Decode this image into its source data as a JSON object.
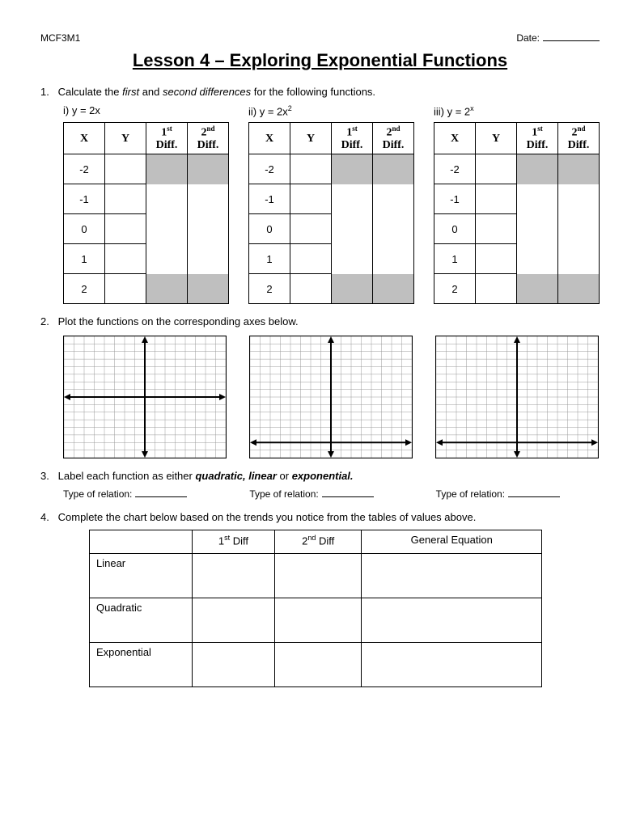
{
  "header": {
    "course": "MCF3M1",
    "date_label": "Date:"
  },
  "title": "Lesson 4 – Exploring Exponential Functions",
  "q1": {
    "num": "1.",
    "text_a": "Calculate the ",
    "text_b": "first",
    "text_c": " and ",
    "text_d": "second differences",
    "text_e": " for the following functions.",
    "funcs": [
      {
        "label": "i)   y = 2x"
      },
      {
        "label_pre": "ii)  y = 2x",
        "label_sup": "2"
      },
      {
        "label_pre": "iii)  y = 2",
        "label_sup": "x"
      }
    ],
    "table_headers": {
      "x": "X",
      "y": "Y",
      "d1a": "1",
      "d1s": "st",
      "d1b": "Diff.",
      "d2a": "2",
      "d2s": "nd",
      "d2b": "Diff."
    },
    "x_values": [
      "-2",
      "-1",
      "0",
      "1",
      "2"
    ]
  },
  "q2": {
    "num": "2.",
    "text": "Plot the functions on the corresponding axes below."
  },
  "q3": {
    "num": "3.",
    "text_a": "Label each function as either ",
    "text_b": "quadratic, linear",
    "text_c": " or ",
    "text_d": "exponential.",
    "type_label": "Type of relation:"
  },
  "q4": {
    "num": "4.",
    "text": "Complete the chart below based on the trends you notice from the tables of values above.",
    "headers": {
      "d1a": "1",
      "d1s": "st",
      "d1t": " Diff",
      "d2a": "2",
      "d2s": "nd",
      "d2t": " Diff",
      "ge": "General Equation"
    },
    "rows": [
      "Linear",
      "Quadratic",
      "Exponential"
    ]
  },
  "chart_data": [
    {
      "type": "scatter",
      "title": "",
      "xlabel": "",
      "ylabel": "",
      "xlim": [
        -8,
        8
      ],
      "ylim": [
        -8,
        8
      ],
      "series": [],
      "grid": true,
      "axis_center": [
        0,
        0
      ]
    },
    {
      "type": "scatter",
      "title": "",
      "xlabel": "",
      "ylabel": "",
      "xlim": [
        -8,
        8
      ],
      "ylim": [
        -2,
        14
      ],
      "series": [],
      "grid": true,
      "axis_center": [
        0,
        0
      ]
    },
    {
      "type": "scatter",
      "title": "",
      "xlabel": "",
      "ylabel": "",
      "xlim": [
        -8,
        8
      ],
      "ylim": [
        -2,
        14
      ],
      "series": [],
      "grid": true,
      "axis_center": [
        0,
        0
      ]
    }
  ]
}
